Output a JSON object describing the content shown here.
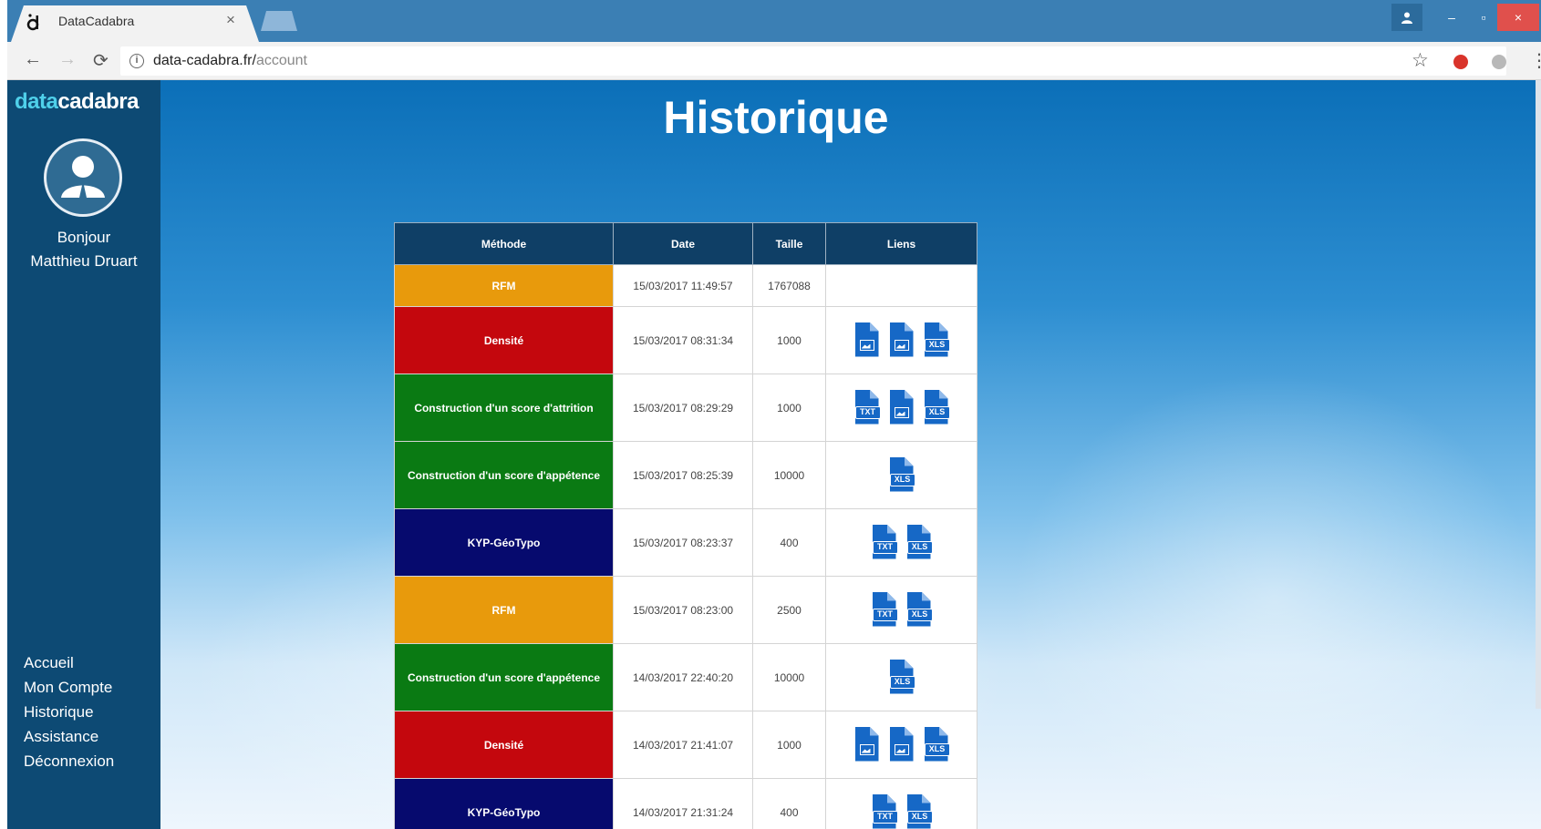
{
  "browser": {
    "tab_title": "DataCadabra",
    "tab_close": "×",
    "url_host": "data-cadabra.fr/",
    "url_path": "account",
    "window_controls": {
      "minimize": "–",
      "maximize": "▫",
      "close": "×"
    }
  },
  "sidebar": {
    "logo_part1": "data",
    "logo_part2": "cadabra",
    "greeting": "Bonjour",
    "user_name": "Matthieu Druart",
    "nav": [
      "Accueil",
      "Mon Compte",
      "Historique",
      "Assistance",
      "Déconnexion"
    ]
  },
  "page": {
    "title": "Historique"
  },
  "table": {
    "headers": [
      "Méthode",
      "Date",
      "Taille",
      "Liens"
    ],
    "rows": [
      {
        "method": "RFM",
        "color": "#e89a0c",
        "date": "15/03/2017 11:49:57",
        "size": "1767088",
        "links": []
      },
      {
        "method": "Densité",
        "color": "#c4070d",
        "date": "15/03/2017 08:31:34",
        "size": "1000",
        "links": [
          "image-file",
          "image-file",
          "xls-file"
        ]
      },
      {
        "method": "Construction d'un score d'attrition",
        "color": "#0a7a13",
        "date": "15/03/2017 08:29:29",
        "size": "1000",
        "links": [
          "txt-file",
          "image-file",
          "xls-file"
        ]
      },
      {
        "method": "Construction d'un score d'appétence",
        "color": "#0a7a13",
        "date": "15/03/2017 08:25:39",
        "size": "10000",
        "links": [
          "xls-file"
        ]
      },
      {
        "method": "KYP-GéoTypo",
        "color": "#060a6e",
        "date": "15/03/2017 08:23:37",
        "size": "400",
        "links": [
          "txt-file",
          "xls-file"
        ]
      },
      {
        "method": "RFM",
        "color": "#e89a0c",
        "date": "15/03/2017 08:23:00",
        "size": "2500",
        "links": [
          "txt-file",
          "xls-file"
        ]
      },
      {
        "method": "Construction d'un score d'appétence",
        "color": "#0a7a13",
        "date": "14/03/2017 22:40:20",
        "size": "10000",
        "links": [
          "xls-file"
        ]
      },
      {
        "method": "Densité",
        "color": "#c4070d",
        "date": "14/03/2017 21:41:07",
        "size": "1000",
        "links": [
          "image-file",
          "image-file",
          "xls-file"
        ]
      },
      {
        "method": "KYP-GéoTypo",
        "color": "#060a6e",
        "date": "14/03/2017 21:31:24",
        "size": "400",
        "links": [
          "txt-file",
          "xls-file"
        ]
      }
    ],
    "file_labels": {
      "txt-file": "TXT",
      "xls-file": "XLS"
    }
  }
}
